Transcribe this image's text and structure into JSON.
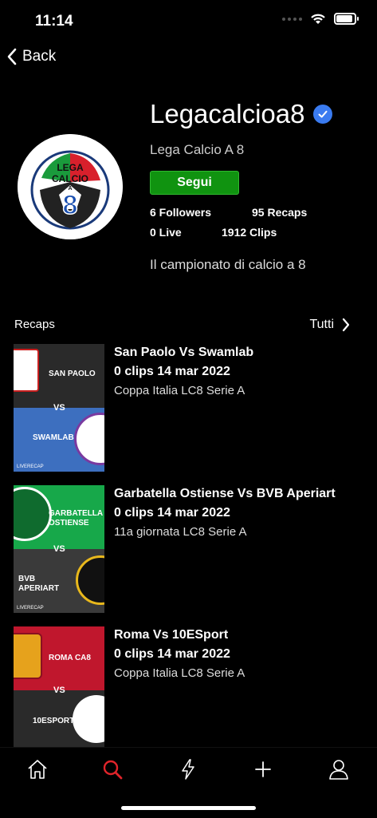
{
  "status_bar": {
    "time": "11:14"
  },
  "nav": {
    "back_label": "Back"
  },
  "profile": {
    "name": "Legacalcioa8",
    "display_name": "Lega Calcio A 8",
    "follow_label": "Segui",
    "followers": "6 Followers",
    "recaps": "95 Recaps",
    "live": "0 Live",
    "clips": "1912 Clips",
    "bio": "Il campionato di calcio a 8",
    "logo_text": [
      "LEGA",
      "CALCIO",
      "A",
      "8"
    ]
  },
  "recaps_section": {
    "title": "Recaps",
    "see_all": "Tutti"
  },
  "recaps": [
    {
      "title": "San Paolo Vs Swamlab",
      "meta": "0 clips 14 mar 2022",
      "competition": "Coppa Italia LC8 Serie A",
      "home": "SAN PAOLO",
      "away": "SWAMLAB",
      "home_color": "#2a2a2a",
      "away_color": "#3d6fbf"
    },
    {
      "title": "Garbatella Ostiense Vs BVB Aperiart",
      "meta": "0 clips 14 mar 2022",
      "competition": "11a giornata LC8 Serie A",
      "home": "GARBATELLA OSTIENSE",
      "away": "BVB APERIART",
      "home_color": "#17a84a",
      "away_color": "#3a3a3a"
    },
    {
      "title": "Roma Vs 10ESport",
      "meta": "0 clips 14 mar 2022",
      "competition": "Coppa Italia LC8 Serie A",
      "home": "ROMA CA8",
      "away": "10ESPORT",
      "home_color": "#c0172d",
      "away_color": "#2a2a2a"
    }
  ],
  "thumb": {
    "vs": "VS",
    "brand": "LIVERECAP"
  },
  "tabbar": {
    "items": [
      "home-icon",
      "search-icon",
      "lightning-icon",
      "plus-icon",
      "profile-icon"
    ],
    "active": "search-icon",
    "active_color": "#e0242a"
  }
}
